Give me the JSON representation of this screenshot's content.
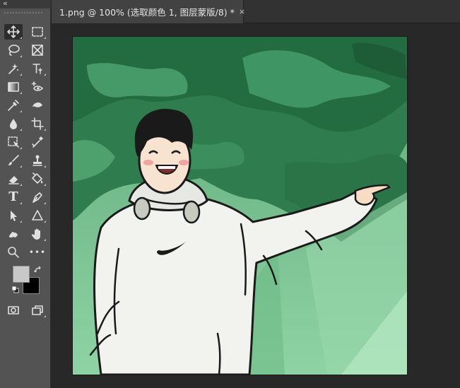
{
  "toolbar": {
    "collapse_icon": "chevron-double-left-icon",
    "tools": [
      {
        "name": "move-tool",
        "icon": "move-icon",
        "active": true
      },
      {
        "name": "marquee-tool",
        "icon": "rect-marquee-icon"
      },
      {
        "name": "lasso-tool",
        "icon": "lasso-icon"
      },
      {
        "name": "frame-tool",
        "icon": "frame-icon"
      },
      {
        "name": "quick-selection-tool",
        "icon": "quick-select-icon"
      },
      {
        "name": "text-type-tool",
        "icon": "text-type-icon"
      },
      {
        "name": "gradient-tool",
        "icon": "gradient-icon"
      },
      {
        "name": "eye-tool",
        "icon": "eye-add-icon"
      },
      {
        "name": "eyedropper-tool",
        "icon": "eyedropper-icon"
      },
      {
        "name": "smudge-tool",
        "icon": "smudge-icon"
      },
      {
        "name": "blur-tool",
        "icon": "drop-icon"
      },
      {
        "name": "crop-tool",
        "icon": "crop-icon"
      },
      {
        "name": "perspective-tool",
        "icon": "perspective-icon"
      },
      {
        "name": "brush-pen-tool",
        "icon": "brush-pen-icon"
      },
      {
        "name": "brush-tool",
        "icon": "brush-icon"
      },
      {
        "name": "stamp-tool",
        "icon": "stamp-icon"
      },
      {
        "name": "eraser-tool",
        "icon": "eraser-icon"
      },
      {
        "name": "paint-bucket-tool",
        "icon": "paint-bucket-icon"
      },
      {
        "name": "type-tool",
        "icon": "type-icon",
        "glyph": "T"
      },
      {
        "name": "pen-tool",
        "icon": "pen-icon"
      },
      {
        "name": "path-selection-tool",
        "icon": "arrow-icon"
      },
      {
        "name": "shape-tool",
        "icon": "triangle-icon"
      },
      {
        "name": "puppet-tool",
        "icon": "puppet-icon"
      },
      {
        "name": "hand-tool",
        "icon": "hand-icon"
      },
      {
        "name": "zoom-tool",
        "icon": "zoom-icon"
      },
      {
        "name": "more-tools",
        "icon": "more-icon",
        "glyph": "•••"
      }
    ],
    "foreground_color": "#c8c8c8",
    "background_color": "#000000",
    "quick_mask_icon": "quick-mask-icon",
    "screen_mode_icon": "screen-mode-icon"
  },
  "tab": {
    "title": "1.png @ 100% (选取颜色 1, 图层蒙版/8) *",
    "close": "×"
  },
  "canvas": {
    "content": "illustration-cartoon-man-pointing",
    "colors": {
      "sky_green": "#7fc596",
      "tree_green": "#2e7a4b",
      "hoodie": "#f2f2ef"
    }
  }
}
